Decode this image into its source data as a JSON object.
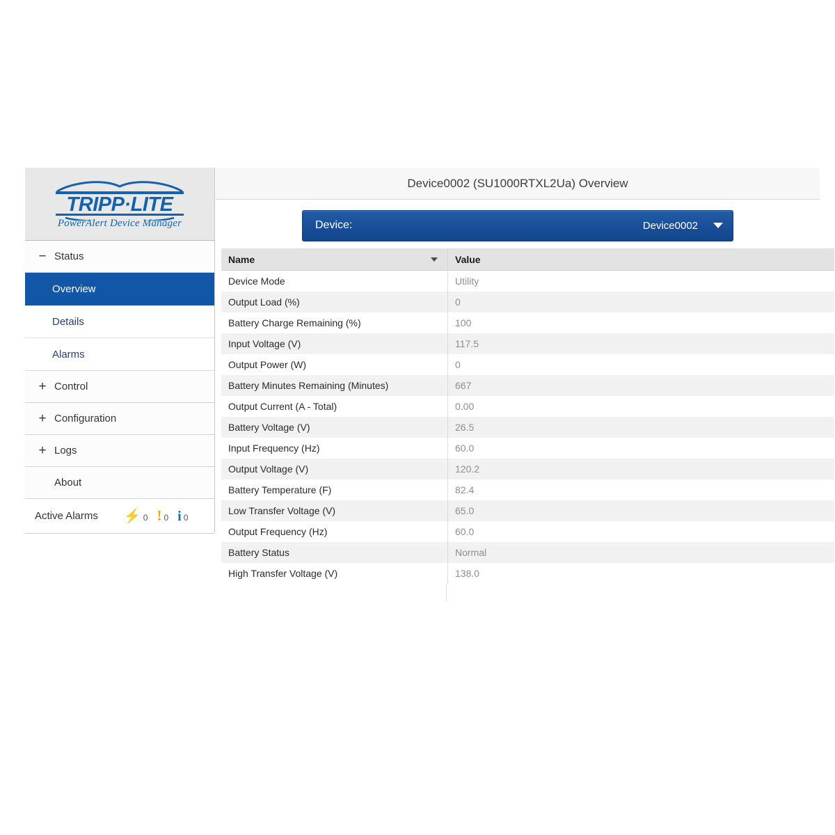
{
  "brand": {
    "name": "TRIPP·LITE",
    "tagline": "PowerAlert Device Manager"
  },
  "sidebar": {
    "groups": [
      {
        "label": "Status",
        "toggle": "−",
        "expanded": true
      },
      {
        "label": "Control",
        "toggle": "+",
        "expanded": false
      },
      {
        "label": "Configuration",
        "toggle": "+",
        "expanded": false
      },
      {
        "label": "Logs",
        "toggle": "+",
        "expanded": false
      },
      {
        "label": "About",
        "toggle": "",
        "expanded": false
      }
    ],
    "status_items": [
      {
        "label": "Overview",
        "active": true
      },
      {
        "label": "Details",
        "active": false
      },
      {
        "label": "Alarms",
        "active": false
      }
    ],
    "active_alarms": {
      "label": "Active Alarms",
      "counters": [
        {
          "icon": "critical-bolt-icon",
          "glyph": "⚡",
          "count": "0",
          "color": "#e8440f"
        },
        {
          "icon": "warning-exclamation-icon",
          "glyph": "!",
          "count": "0",
          "color": "#f5a200"
        },
        {
          "icon": "info-icon",
          "glyph": "i",
          "count": "0",
          "color": "#1071c4"
        }
      ]
    }
  },
  "header": {
    "title": "Device0002 (SU1000RTXL2Ua) Overview"
  },
  "device_selector": {
    "label": "Device:",
    "selected": "Device0002"
  },
  "table": {
    "columns": {
      "name": "Name",
      "value": "Value"
    },
    "rows": [
      {
        "name": "Device Mode",
        "value": "Utility"
      },
      {
        "name": "Output Load (%)",
        "value": "0"
      },
      {
        "name": "Battery Charge Remaining (%)",
        "value": "100"
      },
      {
        "name": "Input Voltage (V)",
        "value": "117.5"
      },
      {
        "name": "Output Power (W)",
        "value": "0"
      },
      {
        "name": "Battery Minutes Remaining (Minutes)",
        "value": "667"
      },
      {
        "name": "Output Current (A - Total)",
        "value": "0.00"
      },
      {
        "name": "Battery Voltage (V)",
        "value": "26.5"
      },
      {
        "name": "Input Frequency (Hz)",
        "value": "60.0"
      },
      {
        "name": "Output Voltage (V)",
        "value": "120.2"
      },
      {
        "name": "Battery Temperature (F)",
        "value": "82.4"
      },
      {
        "name": "Low Transfer Voltage (V)",
        "value": "65.0"
      },
      {
        "name": "Output Frequency (Hz)",
        "value": "60.0"
      },
      {
        "name": "Battery Status",
        "value": "Normal"
      },
      {
        "name": "High Transfer Voltage (V)",
        "value": "138.0"
      }
    ]
  },
  "colors": {
    "brand_blue": "#1461b0",
    "active_nav": "#1256a8",
    "device_bar": "#12458c",
    "header_bg": "#e3e3e3"
  }
}
